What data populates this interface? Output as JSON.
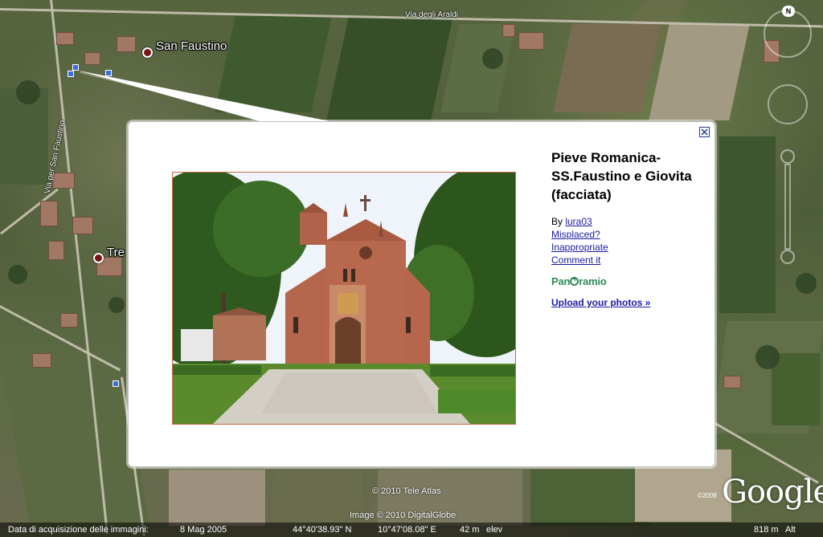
{
  "map": {
    "places": [
      {
        "name": "San Faustino"
      },
      {
        "name": "Tre"
      }
    ],
    "roads": [
      {
        "name": "Via degli Araldi"
      },
      {
        "name": "Via per San Faustino"
      }
    ]
  },
  "balloon": {
    "title": "Pieve Romanica-SS.Faustino e Giovita (facciata)",
    "by_prefix": "By ",
    "author": "lura03",
    "links": [
      "Misplaced?",
      "Inappropriate",
      "Comment it"
    ],
    "logo_text_before": "Pan",
    "logo_text_after": "ramio",
    "upload_label": "Upload your photos »"
  },
  "nav": {
    "north_label": "N"
  },
  "attribution": {
    "tele_atlas": "© 2010 Tele Atlas",
    "digitalglobe": "Image © 2010 DigitalGlobe",
    "google_year": "©2009",
    "google_logo": "Google"
  },
  "status_bar": {
    "date_label": "Data di acquisizione delle immagini:",
    "date_value": "8 Mag 2005",
    "latitude": "44°40'38.93\" N",
    "longitude": "10°47'08.08\" E",
    "elevation": "42 m",
    "elevation_label": "elev",
    "eye_alt": "818 m",
    "eye_alt_label": "Alt"
  },
  "colors": {
    "link": "#1a1aa6",
    "panoramio": "#2e8b57",
    "place_dot": "#7a1515"
  }
}
